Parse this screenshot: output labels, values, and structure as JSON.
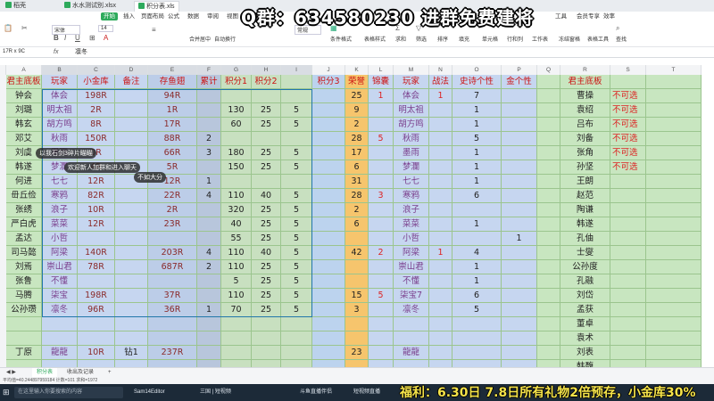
{
  "tabs": [
    "稻壳",
    "水水测试别.xlsx",
    "积分表.xls"
  ],
  "menu": [
    "开始",
    "插入",
    "页面布局",
    "公式",
    "数据",
    "审阅",
    "视图",
    "工具",
    "会员专享",
    "效率"
  ],
  "ribbon": {
    "font_name": "宋体",
    "font_size": "14",
    "wrap": "自动换行",
    "merge": "合并居中",
    "format": "常规",
    "labels": [
      "条件格式",
      "表格样式",
      "求和",
      "筛选",
      "排序",
      "填充",
      "单元格",
      "行和列",
      "工作表",
      "冻结窗格",
      "表格工具",
      "查找"
    ]
  },
  "formula_bar": {
    "name_box": "17R x 9C",
    "fx": "fx",
    "value": "凛冬"
  },
  "columns": [
    "A",
    "B",
    "C",
    "D",
    "E",
    "F",
    "G",
    "H",
    "I",
    "J",
    "K",
    "L",
    "M",
    "N",
    "O",
    "P",
    "Q",
    "R",
    "S",
    "T"
  ],
  "header_row": {
    "a": "君主底板",
    "b": "玩家",
    "c": "小金库",
    "d": "备注",
    "e": "存鱼翅",
    "f": "累计",
    "g": "积分1",
    "h": "积分2",
    "i": "",
    "j": "积分3",
    "k": "荣誉",
    "l": "锦囊",
    "m": "玩家",
    "n": "战法",
    "o": "史诗个性",
    "p": "金个性",
    "q": "",
    "r": "君主底板",
    "s": "",
    "t": ""
  },
  "rows": [
    {
      "a": "钟会",
      "b": "体会",
      "c": "198R",
      "d": "",
      "e": "94R",
      "f": "",
      "g": "",
      "h": "",
      "i": "",
      "j": "",
      "k": "25",
      "l": "1",
      "m": "体会",
      "n": "1",
      "o": "7",
      "p": "",
      "r": "曹操",
      "s": "不可选"
    },
    {
      "a": "刘璐",
      "b": "明太祖",
      "c": "2R",
      "d": "",
      "e": "1R",
      "f": "",
      "g": "130",
      "h": "25",
      "i": "5",
      "j": "",
      "k": "9",
      "l": "",
      "m": "明太祖",
      "n": "",
      "o": "1",
      "p": "",
      "r": "袁绍",
      "s": "不可选"
    },
    {
      "a": "韩玄",
      "b": "胡方鸣",
      "c": "8R",
      "d": "",
      "e": "17R",
      "f": "",
      "g": "60",
      "h": "25",
      "i": "5",
      "j": "",
      "k": "2",
      "l": "",
      "m": "胡方鸣",
      "n": "",
      "o": "1",
      "p": "",
      "r": "吕布",
      "s": "不可选"
    },
    {
      "a": "邓艾",
      "b": "秋雨",
      "c": "150R",
      "d": "",
      "e": "88R",
      "f": "2",
      "g": "",
      "h": "",
      "i": "",
      "j": "",
      "k": "28",
      "l": "5",
      "m": "秋雨",
      "n": "",
      "o": "5",
      "p": "",
      "r": "刘备",
      "s": "不可选"
    },
    {
      "a": "刘虞",
      "b": "墨雨",
      "c": "0R",
      "d": "",
      "e": "66R",
      "f": "3",
      "g": "180",
      "h": "25",
      "i": "5",
      "j": "",
      "k": "17",
      "l": "",
      "m": "墨雨",
      "n": "",
      "o": "1",
      "p": "",
      "r": "张角",
      "s": "不可选"
    },
    {
      "a": "韩遂",
      "b": "梦瀾",
      "c": "4R",
      "d": "",
      "e": "5R",
      "f": "",
      "g": "150",
      "h": "25",
      "i": "5",
      "j": "",
      "k": "6",
      "l": "",
      "m": "梦瀾",
      "n": "",
      "o": "1",
      "p": "",
      "r": "孙坚",
      "s": "不可选"
    },
    {
      "a": "何进",
      "b": "七七",
      "c": "12R",
      "d": "",
      "e": "12R",
      "f": "1",
      "g": "",
      "h": "",
      "i": "",
      "j": "",
      "k": "31",
      "l": "",
      "m": "七七",
      "n": "",
      "o": "1",
      "p": "",
      "r": "王朗",
      "s": ""
    },
    {
      "a": "毌丘俭",
      "b": "寒鸦",
      "c": "82R",
      "d": "",
      "e": "22R",
      "f": "4",
      "g": "110",
      "h": "40",
      "i": "5",
      "j": "",
      "k": "28",
      "l": "3",
      "m": "寒鸦",
      "n": "",
      "o": "6",
      "p": "",
      "r": "赵范",
      "s": ""
    },
    {
      "a": "张绣",
      "b": "浪子",
      "c": "10R",
      "d": "",
      "e": "2R",
      "f": "",
      "g": "320",
      "h": "25",
      "i": "5",
      "j": "",
      "k": "2",
      "l": "",
      "m": "浪子",
      "n": "",
      "o": "",
      "p": "",
      "r": "陶谦",
      "s": ""
    },
    {
      "a": "严白虎",
      "b": "菜菜",
      "c": "12R",
      "d": "",
      "e": "23R",
      "f": "",
      "g": "40",
      "h": "25",
      "i": "5",
      "j": "",
      "k": "6",
      "l": "",
      "m": "菜菜",
      "n": "",
      "o": "1",
      "p": "",
      "r": "韩遂",
      "s": ""
    },
    {
      "a": "孟达",
      "b": "小哲",
      "c": "",
      "d": "",
      "e": "",
      "f": "",
      "g": "55",
      "h": "25",
      "i": "5",
      "j": "",
      "k": "",
      "l": "",
      "m": "小哲",
      "n": "",
      "o": "",
      "p": "1",
      "r": "孔伷",
      "s": ""
    },
    {
      "a": "司马懿",
      "b": "阿梁",
      "c": "140R",
      "d": "",
      "e": "203R",
      "f": "4",
      "g": "110",
      "h": "40",
      "i": "5",
      "j": "",
      "k": "42",
      "l": "2",
      "m": "阿梁",
      "n": "1",
      "o": "4",
      "p": "",
      "r": "士燮",
      "s": ""
    },
    {
      "a": "刘焉",
      "b": "崇山君",
      "c": "78R",
      "d": "",
      "e": "687R",
      "f": "2",
      "g": "110",
      "h": "25",
      "i": "5",
      "j": "",
      "k": "",
      "l": "",
      "m": "崇山君",
      "n": "",
      "o": "1",
      "p": "",
      "r": "公孙度",
      "s": ""
    },
    {
      "a": "张鲁",
      "b": "不懂",
      "c": "",
      "d": "",
      "e": "",
      "f": "",
      "g": "5",
      "h": "25",
      "i": "5",
      "j": "",
      "k": "",
      "l": "",
      "m": "不懂",
      "n": "",
      "o": "1",
      "p": "",
      "r": "孔融",
      "s": ""
    },
    {
      "a": "马腾",
      "b": "柒宝",
      "c": "198R",
      "d": "",
      "e": "37R",
      "f": "",
      "g": "110",
      "h": "25",
      "i": "5",
      "j": "",
      "k": "15",
      "l": "5",
      "m": "柒宝7",
      "n": "",
      "o": "6",
      "p": "",
      "r": "刘岱",
      "s": ""
    },
    {
      "a": "公孙瓒",
      "b": "凛冬",
      "c": "96R",
      "d": "",
      "e": "36R",
      "f": "1",
      "g": "70",
      "h": "25",
      "i": "5",
      "j": "",
      "k": "3",
      "l": "",
      "m": "凛冬",
      "n": "",
      "o": "5",
      "p": "",
      "r": "孟获",
      "s": ""
    },
    {
      "a": "",
      "b": "",
      "c": "",
      "d": "",
      "e": "",
      "f": "",
      "g": "",
      "h": "",
      "i": "",
      "j": "",
      "k": "",
      "l": "",
      "m": "",
      "n": "",
      "o": "",
      "p": "",
      "r": "董卓",
      "s": ""
    },
    {
      "a": "",
      "b": "",
      "c": "",
      "d": "",
      "e": "",
      "f": "",
      "g": "",
      "h": "",
      "i": "",
      "j": "",
      "k": "",
      "l": "",
      "m": "",
      "n": "",
      "o": "",
      "p": "",
      "r": "袁术",
      "s": ""
    },
    {
      "a": "丁原",
      "b": "龍龍",
      "c": "10R",
      "d": "钻1",
      "e": "237R",
      "f": "",
      "g": "",
      "h": "",
      "i": "",
      "j": "",
      "k": "23",
      "l": "",
      "m": "龍龍",
      "n": "",
      "o": "",
      "p": "",
      "r": "刘表",
      "s": ""
    },
    {
      "a": "",
      "b": "",
      "c": "",
      "d": "",
      "e": "",
      "f": "",
      "g": "",
      "h": "",
      "i": "",
      "j": "",
      "k": "",
      "l": "",
      "m": "",
      "n": "",
      "o": "",
      "p": "",
      "r": "韩馥",
      "s": ""
    }
  ],
  "sheet_tabs": [
    "积分表",
    "收出及记录"
  ],
  "status": {
    "left": "平均值=40.244897959184  计数=101  求和=1972"
  },
  "taskbar": {
    "search": "在这里输入你要搜索的内容",
    "apps": [
      "Sam14Editor",
      "三国 | 短视频",
      "斗鱼直播伴侣",
      "短视频直播"
    ]
  },
  "overlay": {
    "qq": "Q群：634580230   进群免费建将",
    "promo": "福利：6.30日 7.8日所有礼物2倍预存，小金库30%",
    "bubbles": [
      "欢迎新人加群和进入聊天",
      "以我石剑3碎片瞄瞄",
      "不如大分"
    ]
  }
}
